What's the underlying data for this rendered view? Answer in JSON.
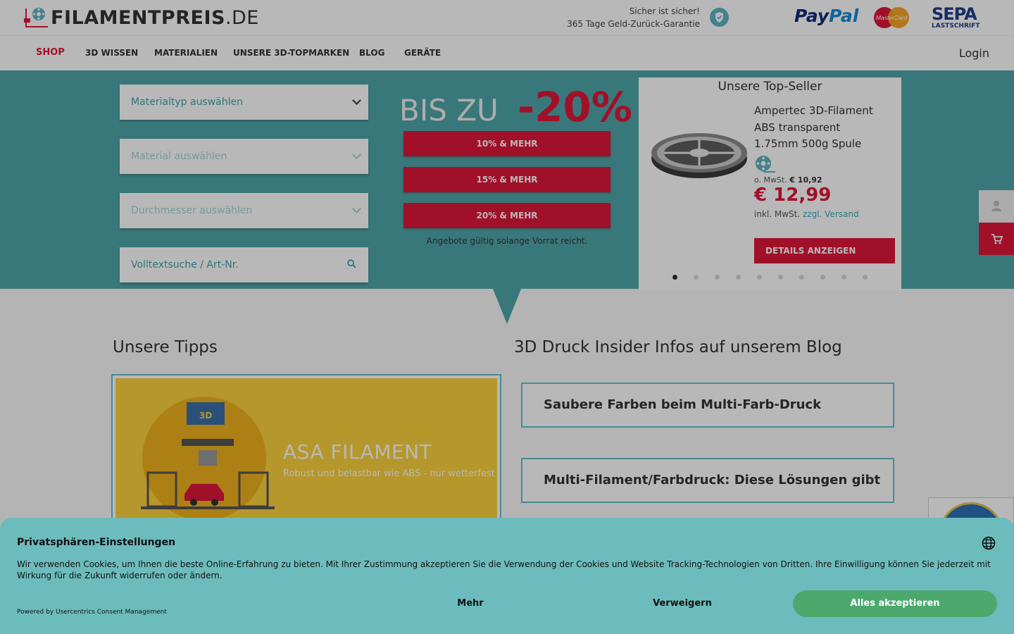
{
  "header": {
    "logo_main": "FILAMENTPREIS",
    "logo_tld": ".DE",
    "guarantee_line1": "Sicher ist sicher!",
    "guarantee_line2": "365 Tage Geld-Zurück-Garantie",
    "payment": {
      "paypal_a": "Pay",
      "paypal_b": "Pal",
      "mastercard": "MasterCard",
      "sepa_top": "SEPA",
      "sepa_bottom": "LASTSCHRIFT"
    }
  },
  "nav": {
    "items": [
      "SHOP",
      "3D WISSEN",
      "MATERIALIEN",
      "UNSERE 3D-TOPMARKEN",
      "BLOG",
      "GERÄTE"
    ],
    "login": "Login"
  },
  "filters": {
    "material_type": "Materialtyp auswählen",
    "material": "Material auswählen",
    "diameter": "Durchmesser auswählen",
    "search_placeholder": "Volltextsuche / Art-Nr."
  },
  "promo": {
    "bis_zu": "BIS ZU",
    "percent": "-20%",
    "buttons": [
      "10% & MEHR",
      "15% & MEHR",
      "20% & MEHR"
    ],
    "note": "Angebote gültig solange Vorrat reicht."
  },
  "topseller": {
    "title": "Unsere Top-Seller",
    "product_line1": "Ampertec 3D-Filament",
    "product_line2": "ABS transparent",
    "product_line3": "1.75mm 500g Spule",
    "net_label": "o. MwSt.",
    "net_price": "€ 10,92",
    "price": "€ 12,99",
    "incl_label": "inkl. MwSt.",
    "shipping_link": "zzgl. Versand",
    "details_button": "DETAILS ANZEIGEN",
    "slide_count": 10,
    "active_slide": 1
  },
  "content": {
    "tipps_title": "Unsere Tipps",
    "tipp_card_title": "ASA FILAMENT",
    "tipp_card_subtitle": "Robust und belastbar wie ABS - nur wetterfest",
    "blog_title": "3D Druck Insider Infos auf unserem Blog",
    "blog_posts": [
      "Saubere Farben beim Multi-Farb-Druck",
      "Multi-Filament/Farbdruck: Diese Lösungen gibt es"
    ]
  },
  "consent": {
    "title": "Privatsphären-Einstellungen",
    "text": "Wir verwenden Cookies, um Ihnen die beste Online-Erfahrung zu bieten. Mit Ihrer Zustimmung akzeptieren Sie die Verwendung der Cookies und Website Tracking-Technologien von Dritten. Ihre Einwilligung können Sie jederzeit mit Wirkung für die Zukunft widerrufen oder ändern.",
    "powered_by": "Powered by Usercentrics Consent Management",
    "more": "Mehr",
    "deny": "Verweigern",
    "accept": "Alles akzeptieren"
  },
  "colors": {
    "brand_red": "#e0173a",
    "teal": "#6dbcbd",
    "accept_green": "#4da86e",
    "tipp_yellow": "#fdd23e"
  }
}
